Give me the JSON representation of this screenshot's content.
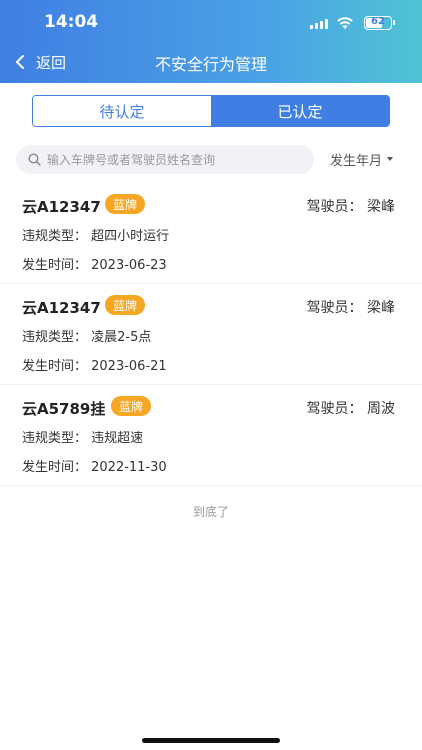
{
  "status_bar": {
    "time": "14:04",
    "battery": "62"
  },
  "navbar": {
    "back_label": "返回",
    "title": "不安全行为管理"
  },
  "tabs": [
    {
      "label": "待认定",
      "active": false
    },
    {
      "label": "已认定",
      "active": true
    }
  ],
  "search": {
    "placeholder": "输入车牌号或者驾驶员姓名查询",
    "value": ""
  },
  "date_filter": {
    "label": "发生年月"
  },
  "records": [
    {
      "plate": "云A12347",
      "badge": "蓝牌",
      "driver": "驾驶员：  梁峰",
      "type": "违规类型：  超四小时运行",
      "time": "发生时间：  2023-06-23"
    },
    {
      "plate": "云A12347",
      "badge": "蓝牌",
      "driver": "驾驶员：  梁峰",
      "type": "违规类型：  凌晨2-5点",
      "time": "发生时间：  2023-06-21"
    },
    {
      "plate": "云A5789挂",
      "badge": "蓝牌",
      "driver": "驾驶员：  周波",
      "type": "违规类型：  违规超速",
      "time": "发生时间：  2022-11-30"
    }
  ],
  "end_text": "到底了",
  "colors": {
    "primary": "#3f7fe3",
    "badge": "#f5a623"
  }
}
